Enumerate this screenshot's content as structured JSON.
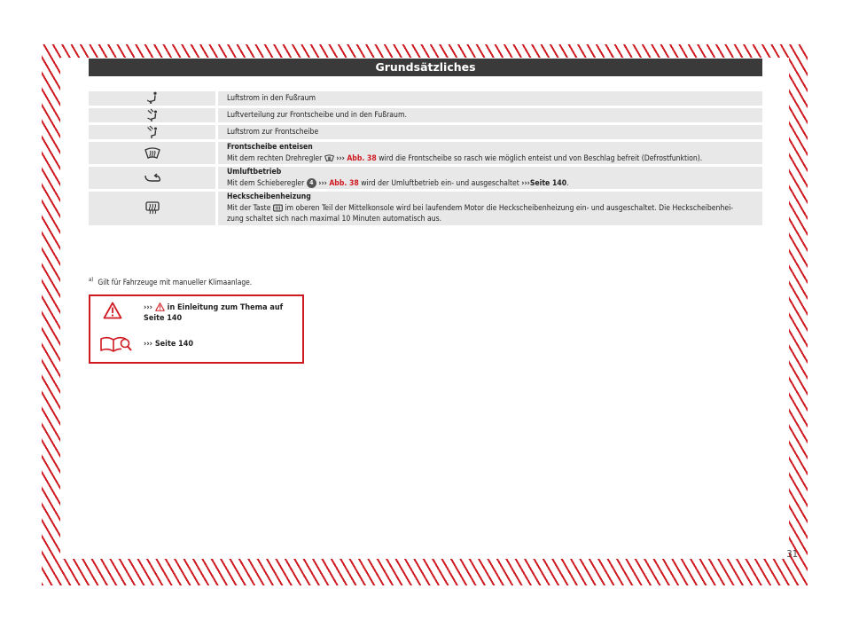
{
  "header": {
    "title": "Grundsätzliches"
  },
  "rows": [
    {
      "icon": "footwell-airflow-icon",
      "title": "",
      "text": "Luftstrom in den Fußraum"
    },
    {
      "icon": "windscreen-footwell-airflow-icon",
      "title": "",
      "text": "Luftverteilung zur Frontscheibe und in den Fußraum."
    },
    {
      "icon": "windscreen-airflow-icon",
      "title": "",
      "text": "Luftstrom zur Frontscheibe"
    },
    {
      "icon": "windscreen-defrost-icon",
      "title": "Frontscheibe enteisen",
      "pre": "Mit dem rechten Drehregler",
      "ref_arrow": "›››",
      "ref": "Abb. 38",
      "post": "wird die Frontscheibe so rasch wie möglich enteist und von Beschlag befreit (Defrostfunktion)."
    },
    {
      "icon": "recirculation-icon",
      "title": "Umluftbetrieb",
      "pre": "Mit dem Schieberegler",
      "badge": "4",
      "ref_arrow": "›››",
      "ref": "Abb. 38",
      "mid": "wird der Umluftbetrieb ein- und ausgeschaltet",
      "page_arrow": "›››",
      "page_ref": "Seite 140",
      "post": "."
    },
    {
      "icon": "rear-window-heating-icon",
      "title": "Heckscheibenheizung",
      "pre": "Mit der Taste",
      "post": "im oberen Teil der Mittelkonsole wird bei laufendem Motor die Heckscheibenheizung ein- und ausgeschaltet. Die Heckscheibenhei-",
      "line2": "zung schaltet sich nach maximal 10 Minuten automatisch aus."
    }
  ],
  "footnote": {
    "marker": "a)",
    "text": "Gilt für Fahrzeuge mit manueller Klimaanlage."
  },
  "warning": {
    "arrow": "›››",
    "ref_text": "in Einleitung zum Thema auf",
    "ref_page": "Seite 140",
    "book_arrow": "›››",
    "book_ref": "Seite 140"
  },
  "page_number": "31",
  "colors": {
    "accent": "#d01a22",
    "header_bg": "#3a3a3a",
    "row_bg": "#e8e8e8"
  }
}
